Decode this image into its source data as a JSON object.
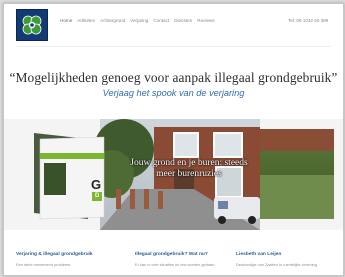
{
  "header": {
    "nav": [
      {
        "label": "Home",
        "active": true
      },
      {
        "label": "Artikelen"
      },
      {
        "label": "Achtergrond"
      },
      {
        "label": "Verjaring"
      },
      {
        "label": "Contact"
      },
      {
        "label": "Diensten"
      },
      {
        "label": "Reviews"
      }
    ],
    "phone": "Tel: 06 1032 60 389"
  },
  "hero_intro": {
    "quote": "“Mogelijkheden genoeg voor aanpak illegaal grondgebruik”",
    "tagline": "Verjaag het spook van de verjaring"
  },
  "hero": {
    "caption_line1": "Jouw grond en je buren: steeds",
    "caption_line2": "meer burenruzies",
    "book_letter": "G",
    "book_badge": "D"
  },
  "footer": {
    "columns": [
      {
        "title": "Verjaring & illegaal grondgebruik",
        "text": "Een sterk toenemend probleem."
      },
      {
        "title": "Illegaal grondgebruik? Wat nu?",
        "text": "Er kan in vele situaties nu iets worden gedaan."
      },
      {
        "title": "Liesbeth van Leijen",
        "text": "Deskundige van Zaaken in ruimtelijke ordening"
      }
    ]
  },
  "colors": {
    "accent_blue": "#2f6db1",
    "logo_blue": "#123a73",
    "green": "#7cb52e"
  }
}
